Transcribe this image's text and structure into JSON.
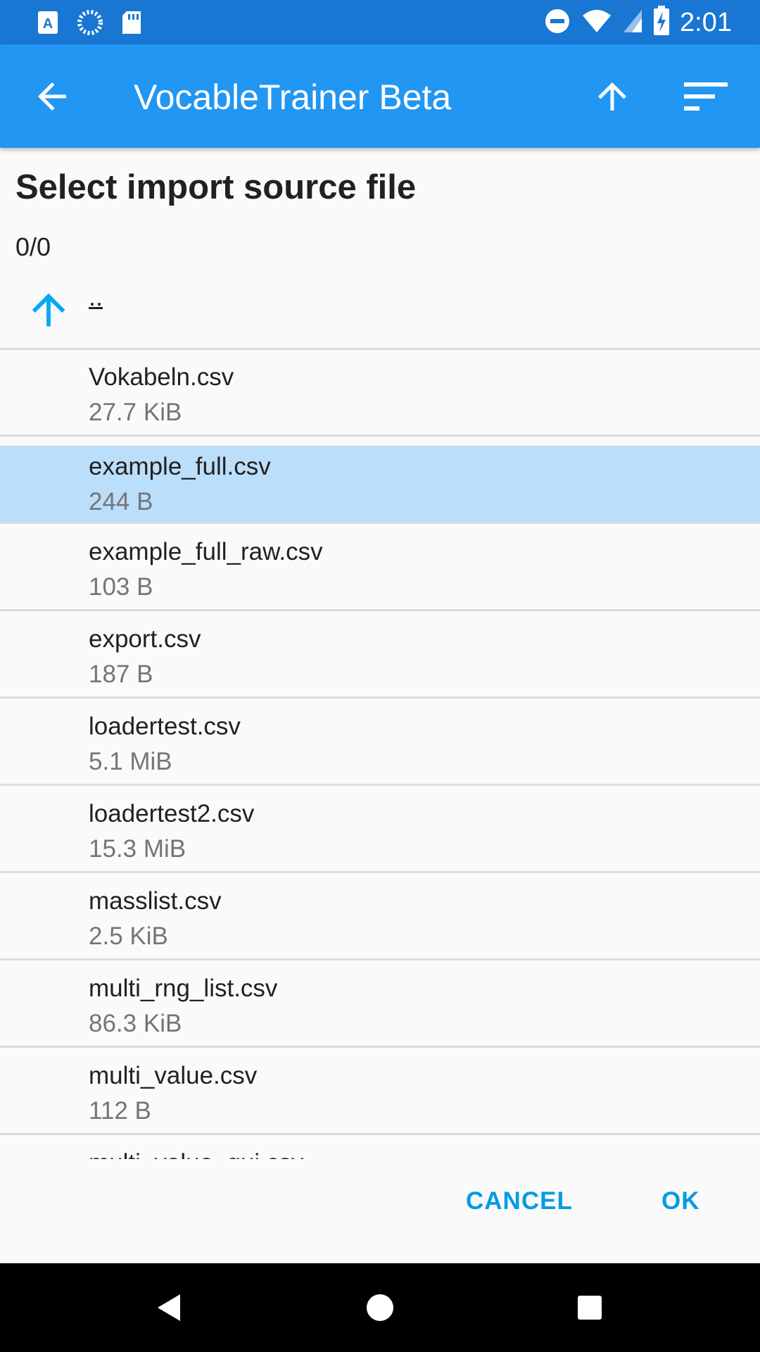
{
  "status_bar": {
    "time": "2:01",
    "left_icons": [
      "font-a-icon",
      "loading-circle-icon",
      "sd-card-icon"
    ],
    "right_icons": [
      "do-not-disturb-icon",
      "wifi-icon",
      "signal-icon",
      "battery-charging-icon"
    ]
  },
  "app_bar": {
    "title": "VocableTrainer Beta",
    "back_icon": "arrow-back-icon",
    "up_icon": "arrow-upward-icon",
    "sort_icon": "sort-icon"
  },
  "dialog": {
    "title": "Select import source file",
    "counter": "0/0",
    "parent_dir_label": ".."
  },
  "files": [
    {
      "name": "Vokabeln.csv",
      "size": "27.7 KiB",
      "selected": false
    },
    {
      "name": "example_full.csv",
      "size": "244 B",
      "selected": true
    },
    {
      "name": "example_full_raw.csv",
      "size": "103 B",
      "selected": false
    },
    {
      "name": "export.csv",
      "size": "187 B",
      "selected": false
    },
    {
      "name": "loadertest.csv",
      "size": "5.1 MiB",
      "selected": false
    },
    {
      "name": "loadertest2.csv",
      "size": "15.3 MiB",
      "selected": false
    },
    {
      "name": "masslist.csv",
      "size": "2.5 KiB",
      "selected": false
    },
    {
      "name": "multi_rng_list.csv",
      "size": "86.3 KiB",
      "selected": false
    },
    {
      "name": "multi_value.csv",
      "size": "112 B",
      "selected": false
    },
    {
      "name": "multi_value_gui.csv",
      "size": "",
      "selected": false
    }
  ],
  "buttons": {
    "cancel": "CANCEL",
    "ok": "OK"
  },
  "colors": {
    "status_bar": "#1976d2",
    "app_bar": "#2196f3",
    "accent": "#039be5",
    "selected_row": "#bbdefb"
  }
}
